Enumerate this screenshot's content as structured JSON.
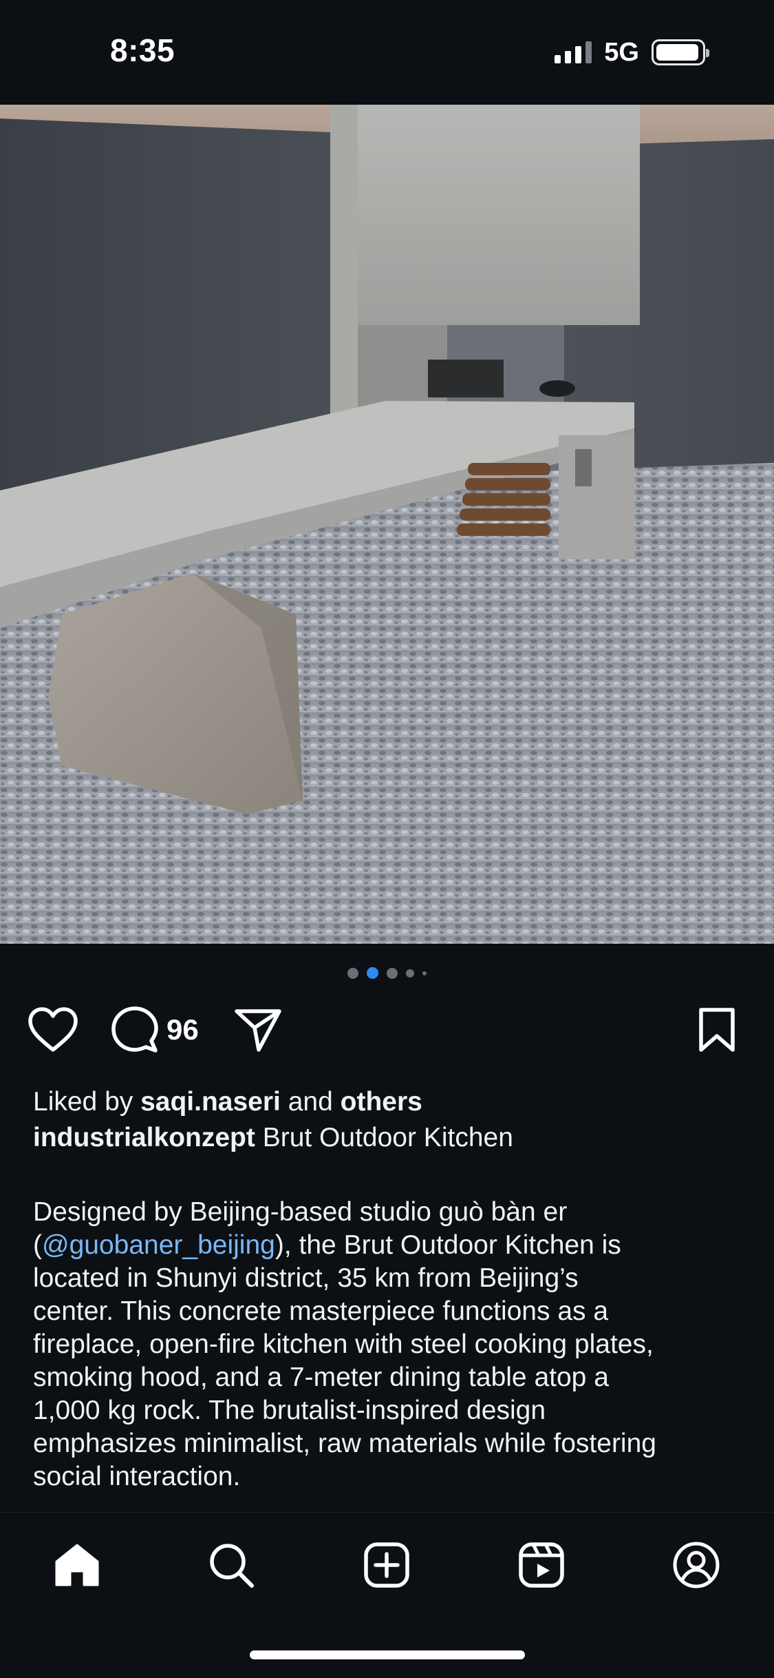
{
  "status_bar": {
    "time": "8:35",
    "network": "5G",
    "signal_bars": 3,
    "battery_level": 0.95
  },
  "post": {
    "image_description_icon": "photo-outdoor-concrete-kitchen",
    "carousel": {
      "total": 5,
      "active_index": 1
    },
    "actions": {
      "like_icon": "heart-icon",
      "comment_icon": "comment-bubble-icon",
      "comment_count": "96",
      "share_icon": "paper-plane-icon",
      "save_icon": "bookmark-icon"
    },
    "likes": {
      "prefix": "Liked by ",
      "user": "saqi.naseri",
      "middle": " and ",
      "others": "others"
    },
    "caption": {
      "username": "industrialkonzept",
      "title": " Brut Outdoor Kitchen",
      "lines": [
        {
          "text": "Designed by Beijing-based studio guò bàn er"
        },
        {
          "pre": "(",
          "mention": "@guobaner_beijing",
          "post": "), the Brut Outdoor Kitchen is"
        },
        {
          "text": "located in Shunyi district, 35 km from Beijing’s"
        },
        {
          "text": "center. This concrete masterpiece functions as a"
        },
        {
          "text": "fireplace, open-fire kitchen with steel cooking plates,"
        },
        {
          "text": "smoking hood, and a 7-meter dining table atop a"
        },
        {
          "text": "1,000 kg rock. The brutalist-inspired design"
        },
        {
          "text": "emphasizes minimalist, raw materials while fostering"
        },
        {
          "text": "social interaction."
        }
      ]
    }
  },
  "tab_bar": {
    "items": [
      {
        "name": "home",
        "icon": "home-icon",
        "active": true
      },
      {
        "name": "search",
        "icon": "search-icon"
      },
      {
        "name": "create",
        "icon": "plus-square-icon"
      },
      {
        "name": "reels",
        "icon": "reels-icon"
      },
      {
        "name": "profile",
        "icon": "profile-icon"
      }
    ]
  },
  "colors": {
    "background": "#0c0f14",
    "text": "#f2f2f2",
    "mention": "#7ab8f5",
    "active_dot": "#2f8cf0"
  }
}
